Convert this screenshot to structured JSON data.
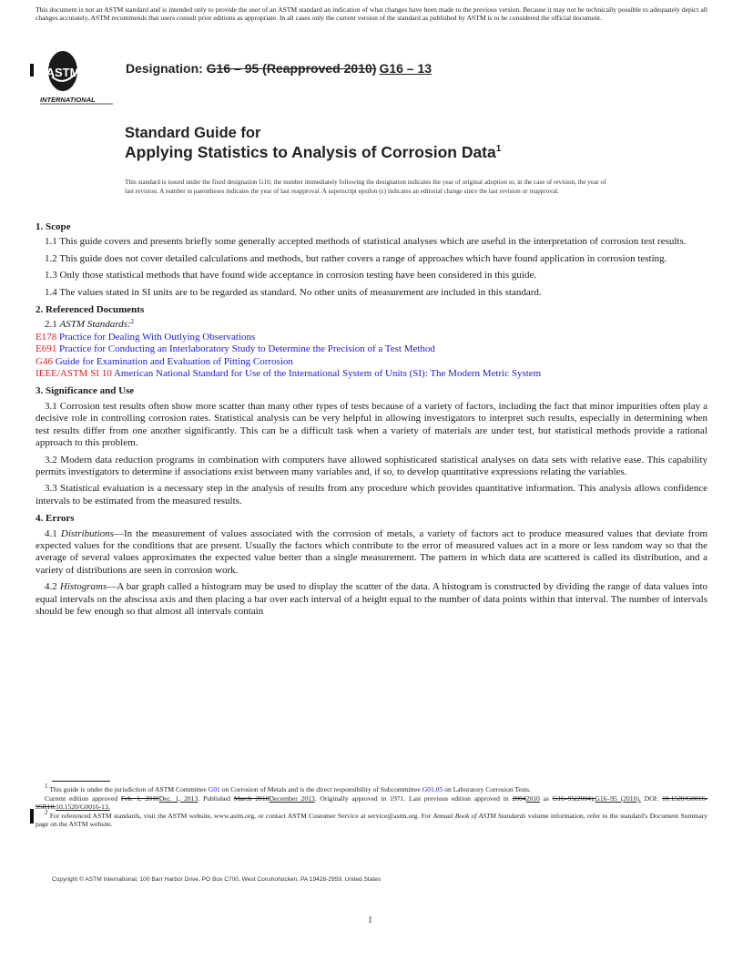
{
  "disclaimer": "This document is not an ASTM standard and is intended only to provide the user of an ASTM standard an indication of what changes have been made to the previous version. Because it may not be technically possible to adequately depict all changes accurately, ASTM recommends that users consult prior editions as appropriate. In all cases only the current version of the standard as published by ASTM is to be considered the official document.",
  "logo": {
    "text": "ASTM",
    "subtext": "INTERNATIONAL"
  },
  "designation": {
    "label": "Designation:",
    "old": "G16 – 95 (Reapproved 2010)",
    "new": "G16 – 13"
  },
  "title": {
    "line1": "Standard Guide for",
    "line2": "Applying Statistics to Analysis of Corrosion Data",
    "footnote_mark": "1"
  },
  "issued_note": "This standard is issued under the fixed designation G16; the number immediately following the designation indicates the year of original adoption or, in the case of revision, the year of last revision. A number in parentheses indicates the year of last reapproval. A superscript epsilon (ε) indicates an editorial change since the last revision or reapproval.",
  "sections": {
    "scope": {
      "heading": "1. Scope",
      "paragraphs": [
        "1.1 This guide covers and presents briefly some generally accepted methods of statistical analyses which are useful in the interpretation of corrosion test results.",
        "1.2 This guide does not cover detailed calculations and methods, but rather covers a range of approaches which have found application in corrosion testing.",
        "1.3 Only those statistical methods that have found wide acceptance in corrosion testing have been considered in this guide.",
        "1.4 The values stated in SI units are to be regarded as standard. No other units of measurement are included in this standard."
      ]
    },
    "referenced": {
      "heading": "2. Referenced Documents",
      "lead_num": "2.1",
      "lead_label": "ASTM Standards:",
      "lead_fn": "2",
      "refs": [
        {
          "code": "E178",
          "title": "Practice for Dealing With Outlying Observations"
        },
        {
          "code": "E691",
          "title": "Practice for Conducting an Interlaboratory Study to Determine the Precision of a Test Method"
        },
        {
          "code": "G46",
          "title": "Guide for Examination and Evaluation of Pitting Corrosion"
        },
        {
          "code": "IEEE/ASTM SI 10",
          "title": "American National Standard for Use of the International System of Units (SI): The Modern Metric System"
        }
      ]
    },
    "significance": {
      "heading": "3. Significance and Use",
      "paragraphs": [
        "3.1 Corrosion test results often show more scatter than many other types of tests because of a variety of factors, including the fact that minor impurities often play a decisive role in controlling corrosion rates. Statistical analysis can be very helpful in allowing investigators to interpret such results, especially in determining when test results differ from one another significantly. This can be a difficult task when a variety of materials are under test, but statistical methods provide a rational approach to this problem.",
        "3.2 Modern data reduction programs in combination with computers have allowed sophisticated statistical analyses on data sets with relative ease. This capability permits investigators to determine if associations exist between many variables and, if so, to develop quantitative expressions relating the variables.",
        "3.3 Statistical evaluation is a necessary step in the analysis of results from any procedure which provides quantitative information. This analysis allows confidence intervals to be estimated from the measured results."
      ]
    },
    "errors": {
      "heading": "4. Errors",
      "p1_num": "4.1",
      "p1_term": "Distributions",
      "p1_text": "—In the measurement of values associated with the corrosion of metals, a variety of factors act to produce measured values that deviate from expected values for the conditions that are present. Usually the factors which contribute to the error of measured values act in a more or less random way so that the average of several values approximates the expected value better than a single measurement. The pattern in which data are scattered is called its distribution, and a variety of distributions are seen in corrosion work.",
      "p2_num": "4.2",
      "p2_term": "Histograms",
      "p2_text": "—A bar graph called a histogram may be used to display the scatter of the data. A histogram is constructed by dividing the range of data values into equal intervals on the abscissa axis and then placing a bar over each interval of a height equal to the number of data points within that interval. The number of intervals should be few enough so that almost all intervals contain"
    }
  },
  "footnotes": {
    "fn1": {
      "mark": "1",
      "a": "This guide is under the jurisdiction of ASTM Committee",
      "link1": "G01",
      "b": "on Corrosion of Metals and is the direct responsibility of Subcommittee",
      "link2": "G01.05",
      "c": "on Laboratory Corrosion Tests."
    },
    "edition": {
      "a": "Current edition approved",
      "old_approved": "Feb. 1, 2010",
      "new_approved": "Dec. 1, 2013",
      "b": ". Published",
      "old_published": "March 2010",
      "new_published": "December 2013",
      "c": ". Originally approved in 1971. Last previous edition approved in",
      "old_year": "2004",
      "new_year": "2010",
      "d": "as",
      "old_prev": "G16–95(2004).",
      "new_prev": "G16–95 (2010).",
      "e": "DOI:",
      "old_doi": "10.1520/G0016-95R10.",
      "new_doi": "10.1520/G0016-13."
    },
    "fn2": {
      "mark": "2",
      "a": "For referenced ASTM standards, visit the ASTM website, www.astm.org, or contact ASTM Customer Service at service@astm.org. For",
      "italic": "Annual Book of ASTM Standards",
      "b": "volume information, refer to the standard's Document Summary page on the ASTM website."
    }
  },
  "copyright": "Copyright © ASTM International, 100 Barr Harbor Drive, PO Box C700, West Conshohocken, PA 19428-2959. United States",
  "page_number": "1"
}
